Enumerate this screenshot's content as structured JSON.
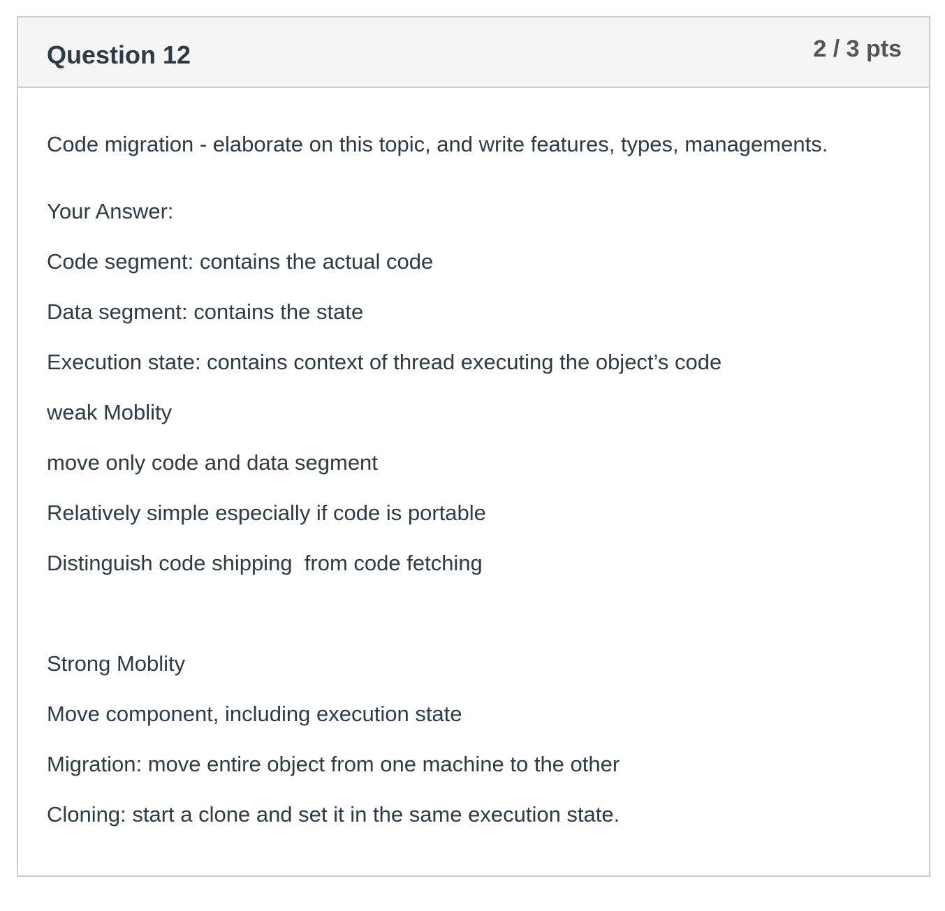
{
  "question": {
    "title": "Question 12",
    "points": "2 / 3 pts",
    "prompt": "Code migration - elaborate on this topic, and write features, types, managements.",
    "answer_label": "Your Answer:",
    "answer_lines": [
      "Code segment: contains the actual code",
      "Data segment: contains the state",
      "Execution state: contains context of thread executing the object’s code",
      "weak Moblity",
      "move only code and data segment",
      "Relatively simple especially if code is portable",
      "Distinguish code shipping  from code fetching",
      "Strong Moblity",
      "Move component, including execution state",
      "Migration: move entire object from one machine to the other",
      "Cloning: start a clone and set it in the same execution state."
    ]
  }
}
